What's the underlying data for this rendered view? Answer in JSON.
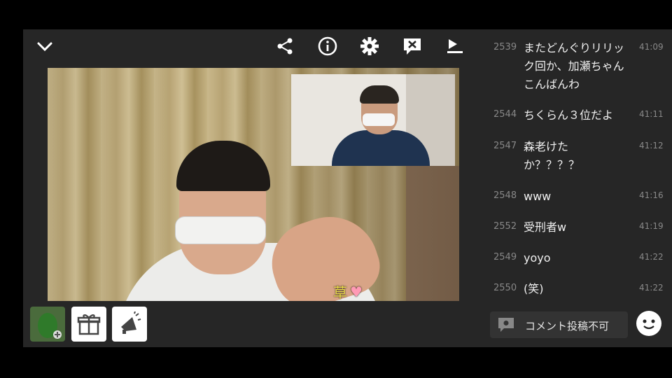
{
  "topbar": {
    "collapse_icon": "chevron-down-icon",
    "icons": [
      "share-icon",
      "info-icon",
      "gear-icon",
      "close-comment-icon",
      "upload-icon"
    ]
  },
  "video": {
    "overlay_text": "草",
    "overlay_heart": "♥"
  },
  "bottom_buttons": [
    "avatar-add-icon",
    "gift-icon",
    "megaphone-icon"
  ],
  "chat": {
    "comments": [
      {
        "num": "2539",
        "text": "またどんぐりリリック回か、加瀬ちゃんこんばんわ",
        "time": "41:09"
      },
      {
        "num": "2544",
        "text": "ちくらん３位だよ",
        "time": "41:11"
      },
      {
        "num": "2547",
        "text": "森老けたか？？？？",
        "time": "41:12"
      },
      {
        "num": "2548",
        "text": "www",
        "time": "41:16"
      },
      {
        "num": "2552",
        "text": "受刑者w",
        "time": "41:19"
      },
      {
        "num": "2549",
        "text": "yoyo",
        "time": "41:22"
      },
      {
        "num": "2550",
        "text": "(笑)",
        "time": "41:22"
      }
    ],
    "input_label": "コメント投稿不可"
  },
  "colors": {
    "background": "#262626",
    "accent": "#ffffff"
  }
}
